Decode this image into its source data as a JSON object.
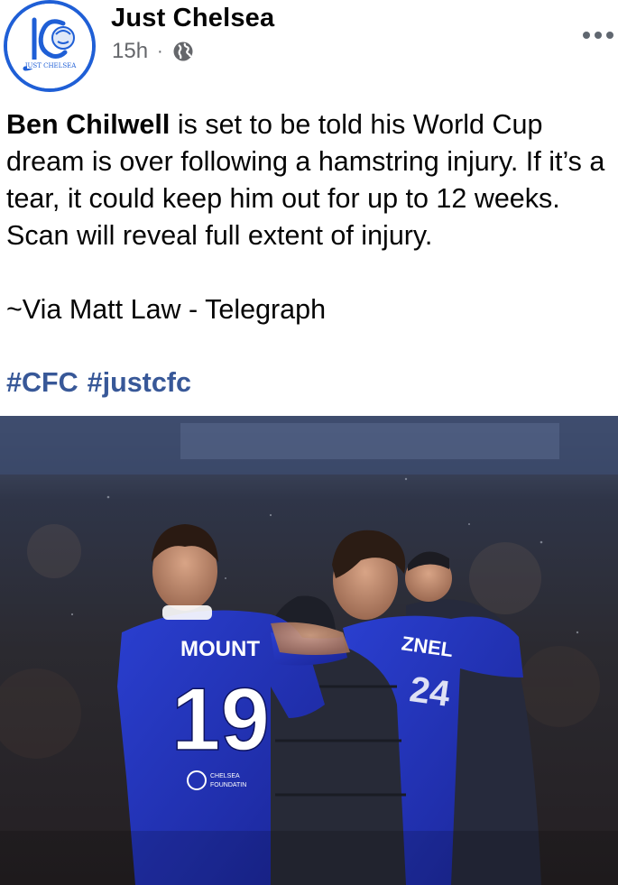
{
  "page": {
    "name": "Just Chelsea",
    "avatar_text": "JUST CHELSEA",
    "timestamp": "15h",
    "separator": "·",
    "privacy_icon": "globe-icon",
    "more_icon": "more-options-icon"
  },
  "post": {
    "bold_name": "Ben Chilwell",
    "body_rest": " is set to be told his World Cup dream is over following a hamstring injury. If it’s a tear, it could keep him out for up to 12 weeks. Scan will reveal full extent of injury.",
    "source": "~Via Matt Law - Telegraph",
    "hashtags": [
      "#CFC",
      "#justcfc"
    ]
  },
  "photo": {
    "jersey_name_left": "MOUNT",
    "jersey_number_left": "19",
    "jersey_name_right": "ZNEL",
    "sponsor_text_1": "CHELSEA",
    "sponsor_text_2": "FOUNDATIN",
    "colors": {
      "kit_blue": "#2233b8",
      "background_dark": "#2a2d3a",
      "jacket_navy": "#262a3c"
    }
  },
  "colors": {
    "name": "#050505",
    "meta": "#65676b",
    "hashtag": "#385898",
    "avatar_ring": "#1f5fd6"
  }
}
